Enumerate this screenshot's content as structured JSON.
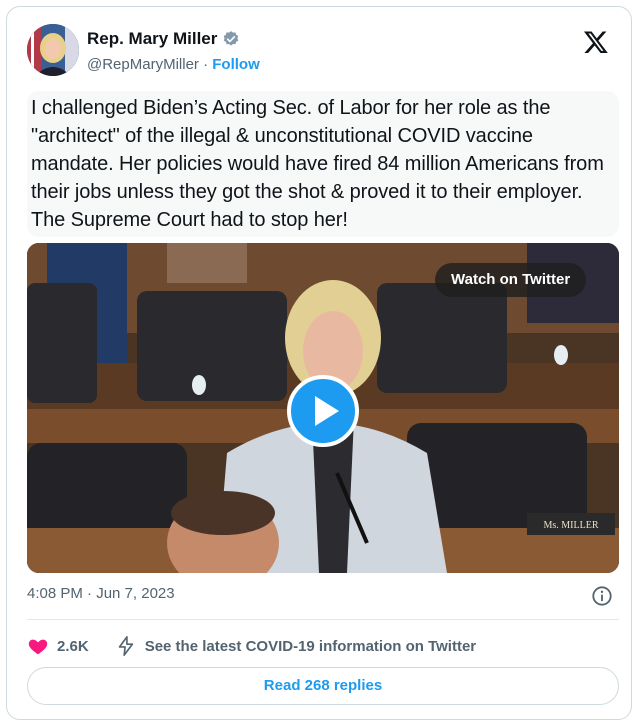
{
  "author": {
    "name": "Rep. Mary Miller",
    "handle": "@RepMaryMiller",
    "separator": "·",
    "follow_label": "Follow",
    "verified": true
  },
  "tweet": {
    "text": "I challenged Biden’s Acting Sec. of Labor for her role as the \"architect\" of the illegal & unconstitutional COVID vaccine mandate. Her policies would have fired 84 million Americans from their jobs unless they got the shot & proved it to their employer. The Supreme Court had to stop her!"
  },
  "media": {
    "type": "video",
    "watch_label": "Watch on Twitter",
    "nameplate": "Ms. MILLER"
  },
  "meta": {
    "timestamp": "4:08 PM · Jun 7, 2023"
  },
  "actions": {
    "like_count": "2.6K",
    "covid_info": "See the latest COVID-19 information on Twitter"
  },
  "replies": {
    "label": "Read 268 replies"
  },
  "icons": {
    "verified": "verified-badge-icon",
    "brand": "x-logo-icon",
    "info": "info-icon",
    "like": "heart-icon",
    "covid": "lightning-icon",
    "play": "play-icon"
  },
  "colors": {
    "accent": "#1d9bf0",
    "like": "#f91880",
    "secondary_text": "#536471",
    "verified": "#829aab"
  }
}
